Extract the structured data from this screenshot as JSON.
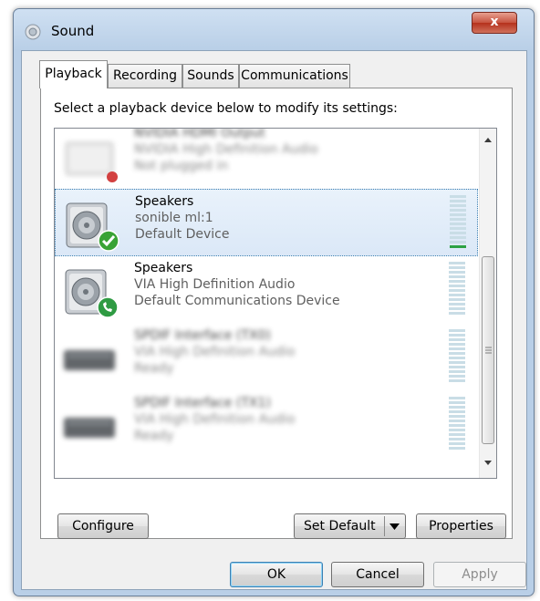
{
  "window": {
    "title": "Sound",
    "close_glyph": "x"
  },
  "tabs": [
    {
      "label": "Playback",
      "active": true
    },
    {
      "label": "Recording",
      "active": false
    },
    {
      "label": "Sounds",
      "active": false
    },
    {
      "label": "Communications",
      "active": false
    }
  ],
  "instruction": "Select a playback device below to modify its settings:",
  "devices": [
    {
      "name": "NVIDIA HDMI Output",
      "desc": "NVIDIA High Definition Audio",
      "status": "Not plugged in",
      "icon": "monitor-icon",
      "badge": "unplugged-badge-icon",
      "blurred": true
    },
    {
      "name": "Speakers",
      "desc": "sonible ml:1",
      "status": "Default Device",
      "icon": "speaker-icon",
      "badge": "default-check-badge-icon",
      "selected": true,
      "level": 0.1
    },
    {
      "name": "Speakers",
      "desc": "VIA High Definition Audio",
      "status": "Default Communications Device",
      "icon": "speaker-icon",
      "badge": "phone-badge-icon",
      "level": 0
    },
    {
      "name": "SPDIF Interface (TX0)",
      "desc": "VIA High Definition Audio",
      "status": "Ready",
      "icon": "digital-output-icon",
      "blurred": true,
      "level": 0
    },
    {
      "name": "SPDIF Interface (TX1)",
      "desc": "VIA High Definition Audio",
      "status": "Ready",
      "icon": "digital-output-icon",
      "blurred": true,
      "level": 0
    }
  ],
  "buttons": {
    "configure": "Configure",
    "set_default": "Set Default",
    "properties": "Properties",
    "ok": "OK",
    "cancel": "Cancel",
    "apply": "Apply"
  },
  "colors": {
    "accent": "#3c7fb1",
    "level_on": "#2ca243",
    "close": "#c6523f"
  }
}
